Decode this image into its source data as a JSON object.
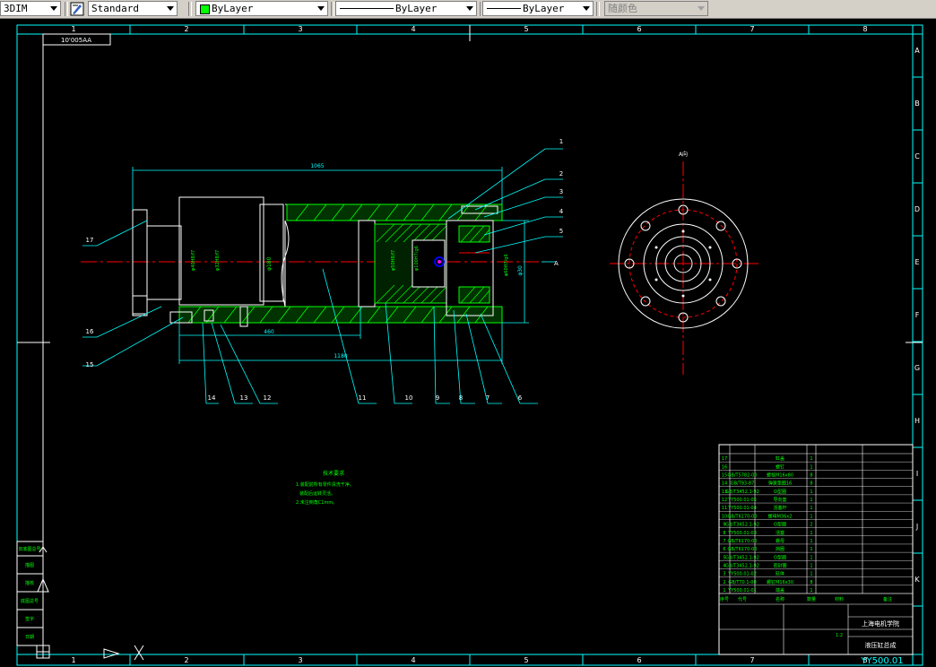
{
  "toolbar": {
    "dim_style": "3DIM",
    "text_style": "Standard",
    "layer_color": "ByLayer",
    "linetype": "ByLayer",
    "lineweight": "ByLayer",
    "plot_style": "随颜色",
    "colors": {
      "layer_swatch": "#00ff00"
    }
  },
  "drawing": {
    "colors": {
      "background": "#000000",
      "border": "#00ffff",
      "outline": "#ffffff",
      "hatch": "#00ff00",
      "center": "#ff0000",
      "dim": "#00ffff"
    },
    "col_labels": [
      "1",
      "2",
      "3",
      "4",
      "5",
      "6",
      "7",
      "8"
    ],
    "row_labels": [
      "A",
      "B",
      "C",
      "D",
      "E",
      "F",
      "G",
      "H",
      "I",
      "J",
      "K"
    ],
    "corner_label": "10'005AA",
    "dims": {
      "overall": "1065",
      "inner": "1180",
      "short": "460",
      "height": "φ180",
      "flange": "φ30",
      "a_mark": "A"
    },
    "view_label": "A向",
    "balloons": [
      "1",
      "2",
      "3",
      "4",
      "5",
      "6",
      "7",
      "8",
      "9",
      "10",
      "11",
      "12",
      "13",
      "14",
      "15",
      "16",
      "17"
    ],
    "notes": {
      "title": "技术要求",
      "line1": "1.装配前所有零件清洗干净。",
      "line2": "装配后运转灵活。",
      "line3": "2.未注倒角C1mm。"
    },
    "title_block": {
      "school": "上海电机学院",
      "name": "液压缸总成",
      "drawing_no": "YY500.01",
      "scale": "1:2",
      "parts": [
        {
          "no": "17",
          "code": "",
          "name": "缸盖",
          "qty": "1"
        },
        {
          "no": "16",
          "code": "",
          "name": "螺钉",
          "qty": "1"
        },
        {
          "no": "15",
          "code": "GB/T5782-00",
          "name": "螺栓M16x80",
          "qty": "8"
        },
        {
          "no": "14",
          "code": "GB/T93-87",
          "name": "弹簧垫圈16",
          "qty": "8"
        },
        {
          "no": "13",
          "code": "GB/T3452.1-92",
          "name": "O型圈",
          "qty": "1"
        },
        {
          "no": "12",
          "code": "YY500.01-05",
          "name": "导向套",
          "qty": "1"
        },
        {
          "no": "11",
          "code": "YY500.01-04",
          "name": "活塞杆",
          "qty": "1"
        },
        {
          "no": "10",
          "code": "GB/T6170-00",
          "name": "螺母M36x2",
          "qty": "1"
        },
        {
          "no": "9",
          "code": "GB/T3452.1-92",
          "name": "O型圈",
          "qty": "2"
        },
        {
          "no": "8",
          "code": "YY500.01-03",
          "name": "活塞",
          "qty": "1"
        },
        {
          "no": "7",
          "code": "GB/T6170-00",
          "name": "螺母",
          "qty": "1"
        },
        {
          "no": "6",
          "code": "GB/T6170-00",
          "name": "挡圈",
          "qty": "1"
        },
        {
          "no": "5",
          "code": "GB/T3452.1-92",
          "name": "O型圈",
          "qty": "1"
        },
        {
          "no": "4",
          "code": "GB/T3452.1-92",
          "name": "密封圈",
          "qty": "1"
        },
        {
          "no": "3",
          "code": "YY500.01-02",
          "name": "缸体",
          "qty": "1"
        },
        {
          "no": "2",
          "code": "GB/T70.1-00",
          "name": "螺钉M16x30",
          "qty": "8"
        },
        {
          "no": "1",
          "code": "YY500.01-01",
          "name": "端盖",
          "qty": "1"
        }
      ],
      "header": {
        "no": "序号",
        "code": "代号",
        "name": "名称",
        "qty": "数量",
        "material": "材料",
        "remark": "备注"
      },
      "small_table": [
        "描图",
        "描校",
        "旧底图总号",
        "底图总号",
        "签字",
        "日期"
      ]
    }
  }
}
